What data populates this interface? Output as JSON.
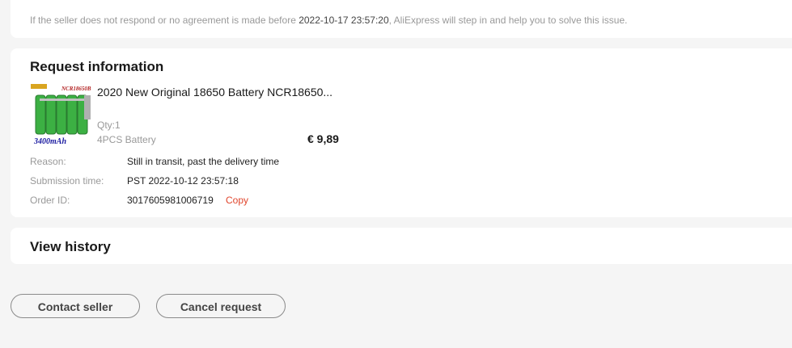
{
  "notice": {
    "prefix": "If the seller does not respond or no agreement is made before ",
    "deadline": "2022-10-17 23:57:20",
    "suffix": ", AliExpress will step in and help you to solve this issue."
  },
  "request": {
    "title": "Request information",
    "product": {
      "image_label_top": "NCR18650B",
      "image_label_bottom": "3400mAh",
      "title": "2020 New Original 18650 Battery NCR18650...",
      "qty": "Qty:1",
      "sku": "4PCS Battery",
      "price": "€ 9,89"
    },
    "details": [
      {
        "label": "Reason:",
        "value": "Still in transit, past the delivery time"
      },
      {
        "label": "Submission time:",
        "value": "PST 2022-10-12 23:57:18"
      },
      {
        "label": "Order ID:",
        "value": "3017605981006719",
        "action": "Copy"
      }
    ]
  },
  "history": {
    "title": "View history"
  },
  "actions": {
    "contact_seller": "Contact seller",
    "cancel_request": "Cancel request"
  },
  "colors": {
    "accent": "#fd4b1f",
    "copy_link": "#e0452c",
    "battery_green": "#3cb043"
  }
}
